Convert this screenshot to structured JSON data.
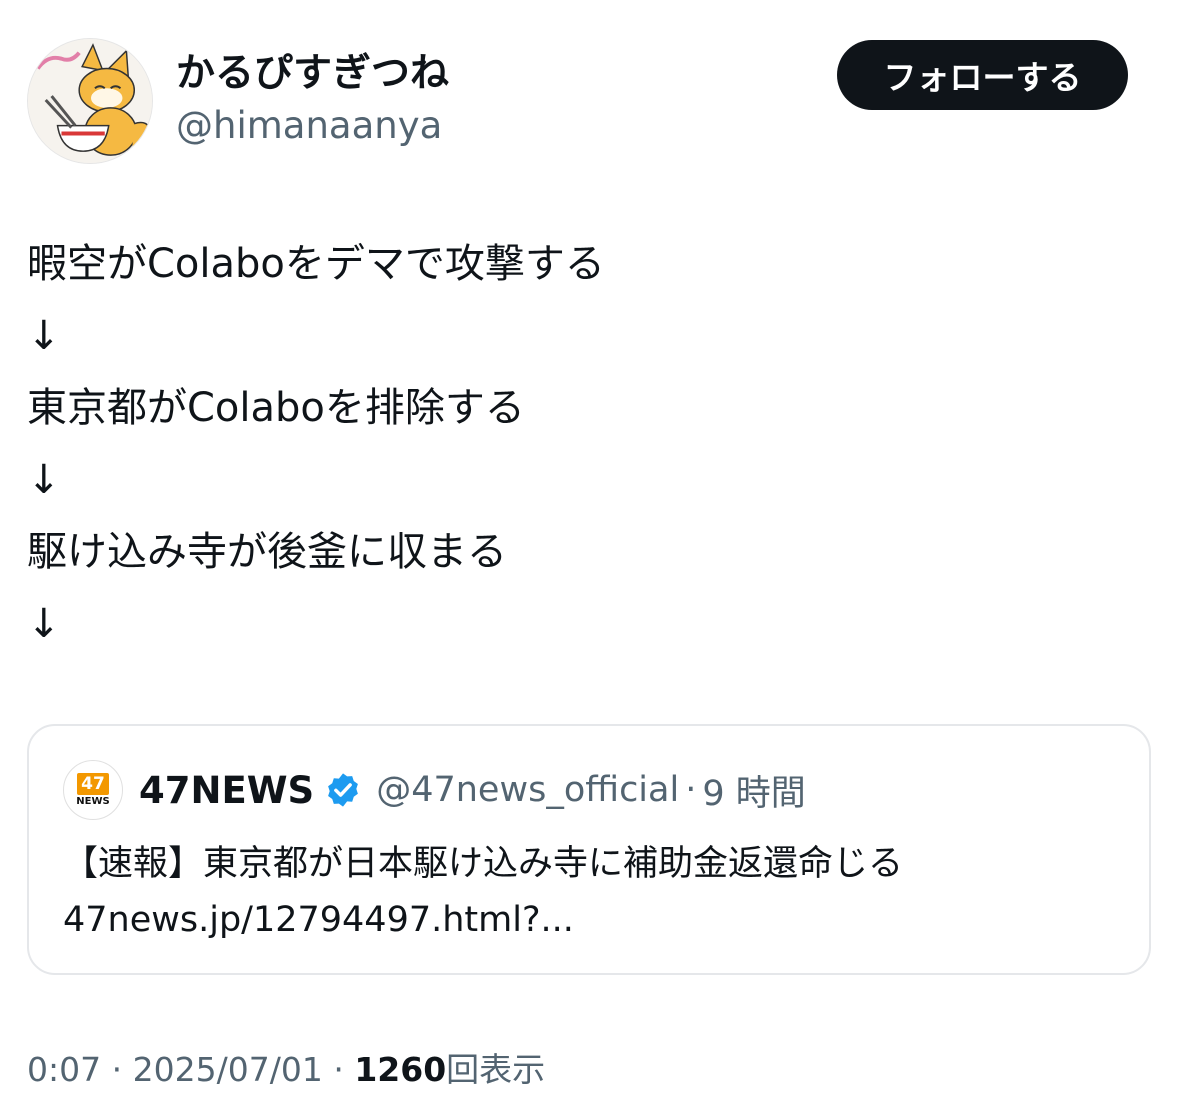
{
  "author": {
    "display_name": "かるぴすぎつね",
    "handle": "@himanaanya",
    "avatar_icon": "fox-character-avatar"
  },
  "follow_button": {
    "label": "フォローする"
  },
  "tweet": {
    "lines": [
      "暇空がColaboをデマで攻撃する",
      "↓",
      "東京都がColaboを排除する",
      "↓",
      "駆け込み寺が後釜に収まる",
      "↓"
    ]
  },
  "quote": {
    "avatar_number": "47",
    "avatar_word": "NEWS",
    "name": "47NEWS",
    "verified_icon": "verified-badge-icon",
    "handle": "@47news_official",
    "separator": "·",
    "time": "9 時間",
    "text_line1": "【速報】東京都が日本駆け込み寺に補助金返還命じる",
    "text_line2": "47news.jp/12794497.html?..."
  },
  "meta": {
    "time": "0:07",
    "separator": "·",
    "date": "2025/07/01",
    "views_count": "1260",
    "views_label": "回表示"
  },
  "colors": {
    "text_primary": "#0f1419",
    "text_secondary": "#536471",
    "button_bg": "#0f1419",
    "verified_blue": "#1d9bf0",
    "news_orange": "#f39800",
    "card_border": "#e5e7ea"
  }
}
